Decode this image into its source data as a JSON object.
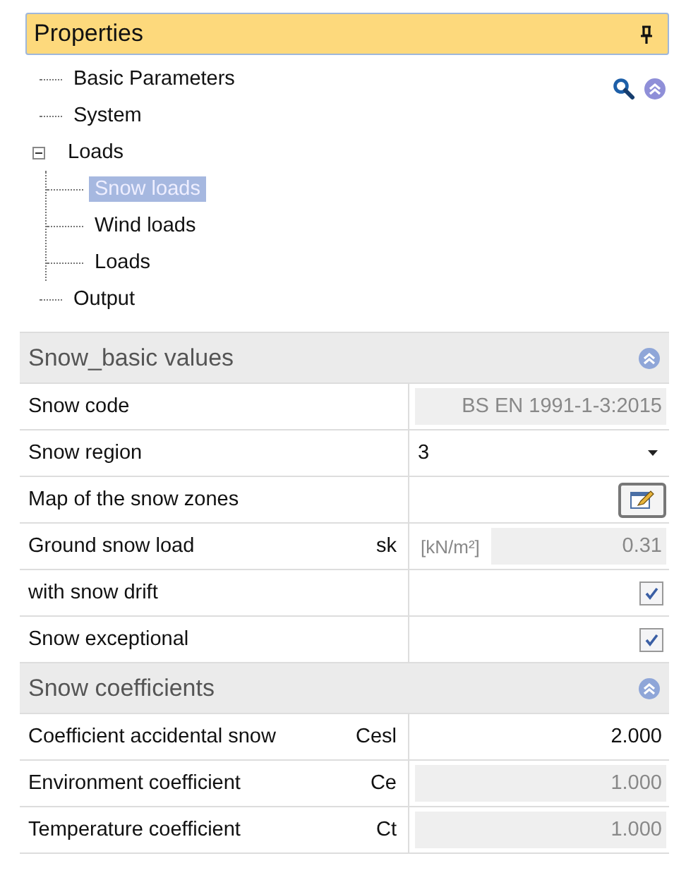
{
  "panel": {
    "title": "Properties"
  },
  "tree": [
    {
      "label": "Basic Parameters",
      "selected": false
    },
    {
      "label": "System",
      "selected": false
    },
    {
      "label": "Loads",
      "selected": false,
      "expanded": true,
      "children": [
        {
          "label": "Snow loads",
          "selected": true
        },
        {
          "label": "Wind loads",
          "selected": false
        },
        {
          "label": "Loads",
          "selected": false
        }
      ]
    },
    {
      "label": "Output",
      "selected": false
    }
  ],
  "sections": [
    {
      "title": "Snow_basic values",
      "expanded": true,
      "rows": [
        {
          "kind": "text",
          "label": "Snow code",
          "value": "BS EN 1991-1-3:2015",
          "disabled": true
        },
        {
          "kind": "dropdown",
          "label": "Snow region",
          "value": "3"
        },
        {
          "kind": "button",
          "label": "Map of the snow zones"
        },
        {
          "kind": "text",
          "label": "Ground snow load",
          "symbol": "sk",
          "unit": "[kN/m²]",
          "value": "0.31",
          "disabled": true
        },
        {
          "kind": "checkbox",
          "label": "with snow drift",
          "checked": true
        },
        {
          "kind": "checkbox",
          "label": "Snow exceptional",
          "checked": true
        }
      ]
    },
    {
      "title": "Snow coefficients",
      "expanded": true,
      "rows": [
        {
          "kind": "text",
          "label": "Coefficient accidental snow",
          "symbol": "Cesl",
          "value": "2.000",
          "disabled": false
        },
        {
          "kind": "text",
          "label": "Environment coefficient",
          "symbol": "Ce",
          "value": "1.000",
          "disabled": true
        },
        {
          "kind": "text",
          "label": "Temperature coefficient",
          "symbol": "Ct",
          "value": "1.000",
          "disabled": true
        }
      ]
    }
  ]
}
